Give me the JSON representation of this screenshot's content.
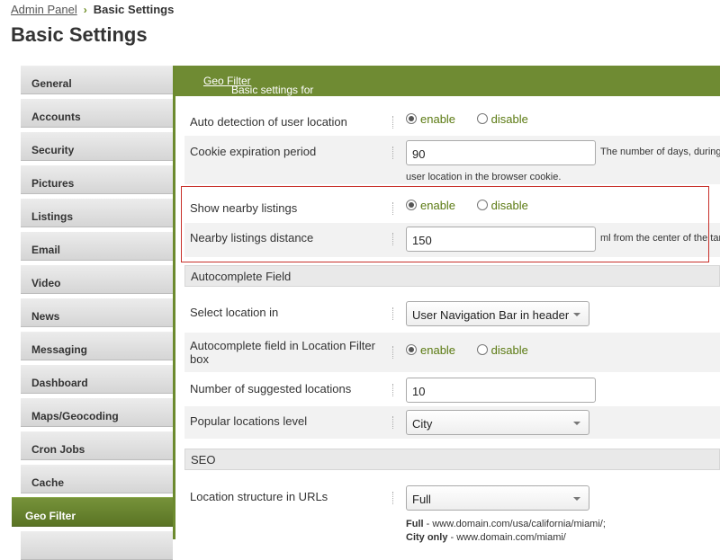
{
  "breadcrumb": {
    "parent": "Admin Panel",
    "current": "Basic Settings"
  },
  "page_title": "Basic Settings",
  "tabs": [
    {
      "label": "General"
    },
    {
      "label": "Accounts"
    },
    {
      "label": "Security"
    },
    {
      "label": "Pictures"
    },
    {
      "label": "Listings"
    },
    {
      "label": "Email"
    },
    {
      "label": "Video"
    },
    {
      "label": "News"
    },
    {
      "label": "Messaging"
    },
    {
      "label": "Dashboard"
    },
    {
      "label": "Maps/Geocoding"
    },
    {
      "label": "Cron Jobs"
    },
    {
      "label": "Cache"
    },
    {
      "label": "Geo Filter"
    }
  ],
  "active_tab": "Geo Filter",
  "panel": {
    "header_prefix": "Basic settings for",
    "header_link": "Geo Filter"
  },
  "radio": {
    "enable": "enable",
    "disable": "disable"
  },
  "settings": {
    "auto_detect": {
      "label": "Auto detection of user location",
      "selected": "enable"
    },
    "cookie": {
      "label": "Cookie expiration period",
      "value": "90",
      "hint": "The number of days, during",
      "hint2": "user location in the browser cookie."
    },
    "show_nearby": {
      "label": "Show nearby listings",
      "selected": "enable"
    },
    "nearby_distance": {
      "label": "Nearby listings distance",
      "value": "150",
      "hint": "ml from the center of the tar"
    },
    "autocomplete_section": "Autocomplete Field",
    "select_location": {
      "label": "Select location in",
      "value": "User Navigation Bar in header"
    },
    "autocomplete_filter": {
      "label": "Autocomplete field in Location Filter box",
      "selected": "enable"
    },
    "suggested": {
      "label": "Number of suggested locations",
      "value": "10"
    },
    "popular_level": {
      "label": "Popular locations level",
      "value": "City"
    },
    "seo_section": "SEO",
    "url_structure": {
      "label": "Location structure in URLs",
      "value": "Full",
      "hint_full_key": "Full",
      "hint_full_val": " - www.domain.com/usa/california/miami/;",
      "hint_city_key": "City only",
      "hint_city_val": " - www.domain.com/miami/"
    }
  },
  "colors": {
    "accent_green": "#6f8b33",
    "highlight_red": "#c8302a"
  }
}
